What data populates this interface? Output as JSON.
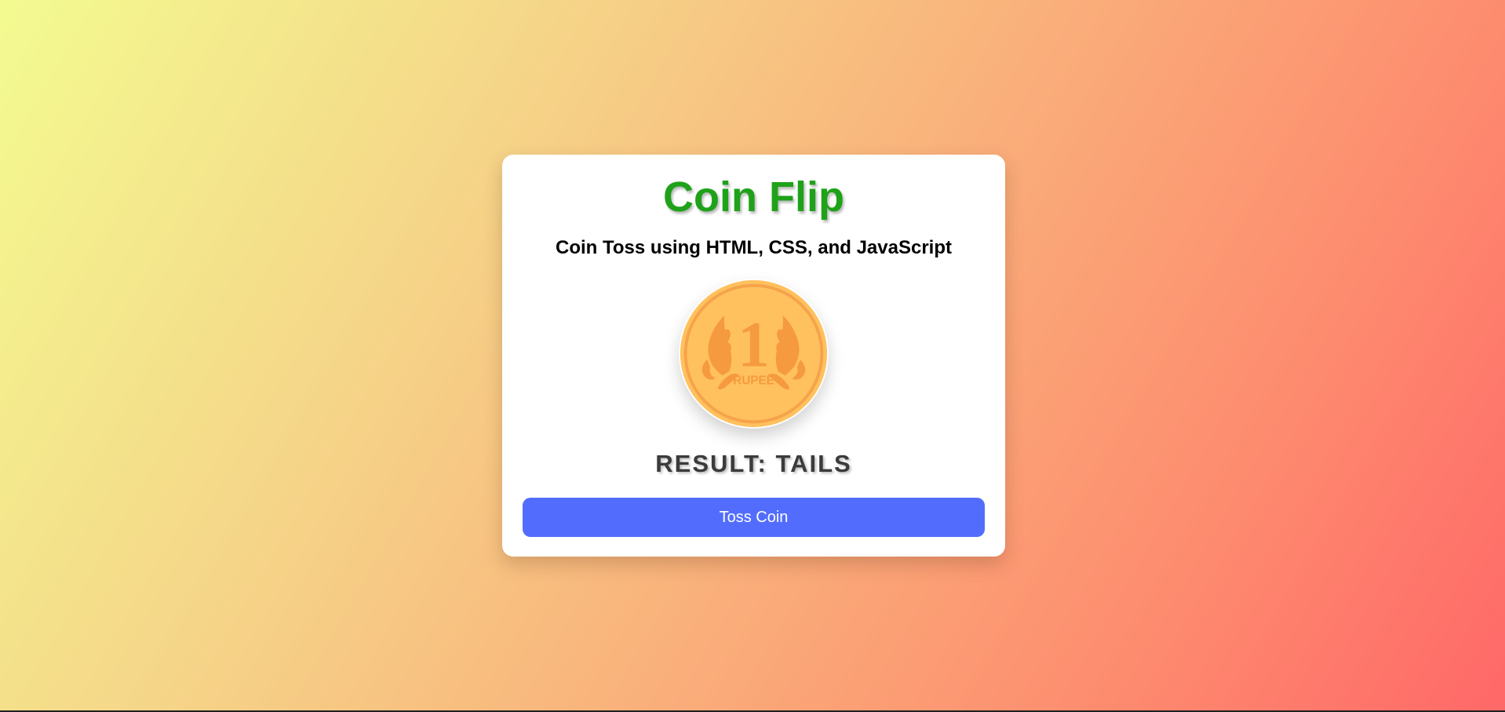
{
  "app": {
    "title": "Coin Flip",
    "subtitle": "Coin Toss using HTML, CSS, and JavaScript"
  },
  "coin": {
    "denomination": "1",
    "currency_label": "RUPEE",
    "face_color": "#ffc15d",
    "mark_color": "#f69a3f"
  },
  "result": {
    "text": "RESULT: TAILS"
  },
  "toss_button": {
    "label": "Toss Coin"
  },
  "colors": {
    "title": "#1fa21a",
    "button": "#526dfd",
    "card": "#ffffff"
  }
}
